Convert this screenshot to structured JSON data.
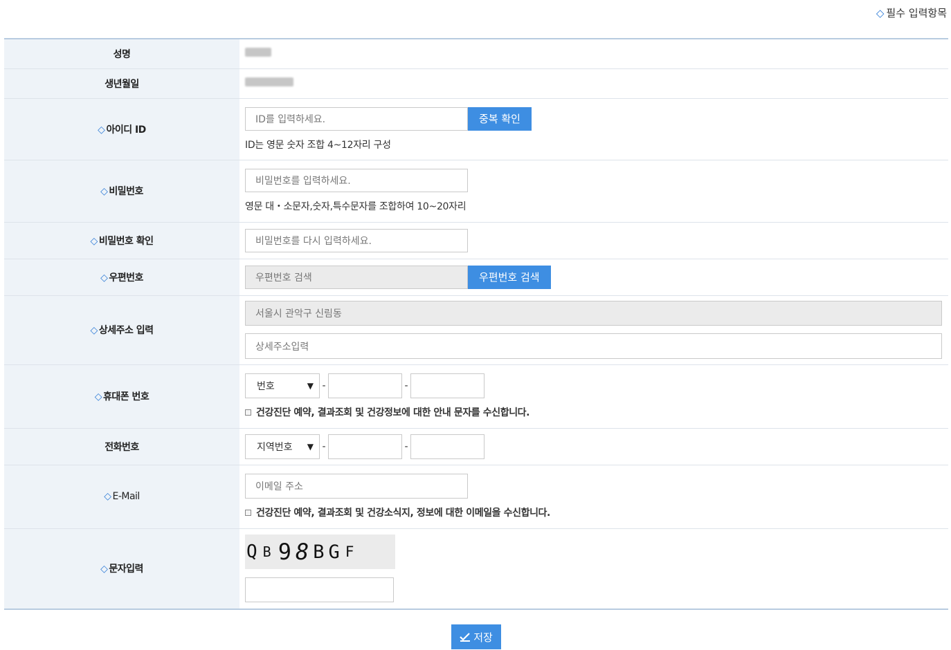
{
  "required_note": "필수 입력항목",
  "marker": "◇",
  "fields": {
    "name": {
      "label": "성명"
    },
    "birth": {
      "label": "생년월일"
    },
    "user_id": {
      "label": "아이디 ID",
      "placeholder": "ID를 입력하세요.",
      "button": "중복 확인",
      "help": "ID는 영문 숫자 조합 4~12자리 구성"
    },
    "password": {
      "label": "비밀번호",
      "placeholder": "비밀번호를 입력하세요.",
      "help": "영문 대・소문자,숫자,특수문자를 조합하여 10~20자리"
    },
    "password_confirm": {
      "label": "비밀번호 확인",
      "placeholder": "비밀번호를 다시 입력하세요."
    },
    "zipcode": {
      "label": "우편번호",
      "placeholder": "우편번호 검색",
      "button": "우편번호 검색"
    },
    "address": {
      "label": "상세주소 입력",
      "base_value": "서울시 관악구 신림동",
      "detail_placeholder": "상세주소입력"
    },
    "mobile": {
      "label": "휴대폰 번호",
      "select_value": "번호",
      "dash": "-",
      "consent": "건강진단 예약, 결과조회 및 건강정보에 대한 안내 문자를 수신합니다."
    },
    "phone": {
      "label": "전화번호",
      "select_value": "지역번호",
      "dash": "-"
    },
    "email": {
      "label": "E-Mail",
      "placeholder": "이메일 주소",
      "consent": "건강진단 예약, 결과조회 및 건강소식지, 정보에 대한 이메일을 수신합니다."
    },
    "captcha": {
      "label": "문자입력",
      "chars": [
        "Q",
        "B",
        "9",
        "8",
        "B",
        "G",
        "F"
      ]
    }
  },
  "save_button": "저장",
  "colors": {
    "accent": "#3e8ee2",
    "label_bg": "#eef3f8",
    "marker": "#2e7bd6"
  },
  "icons": {
    "save": "pencil-check-icon",
    "select_arrow": "triangle-down-icon"
  }
}
